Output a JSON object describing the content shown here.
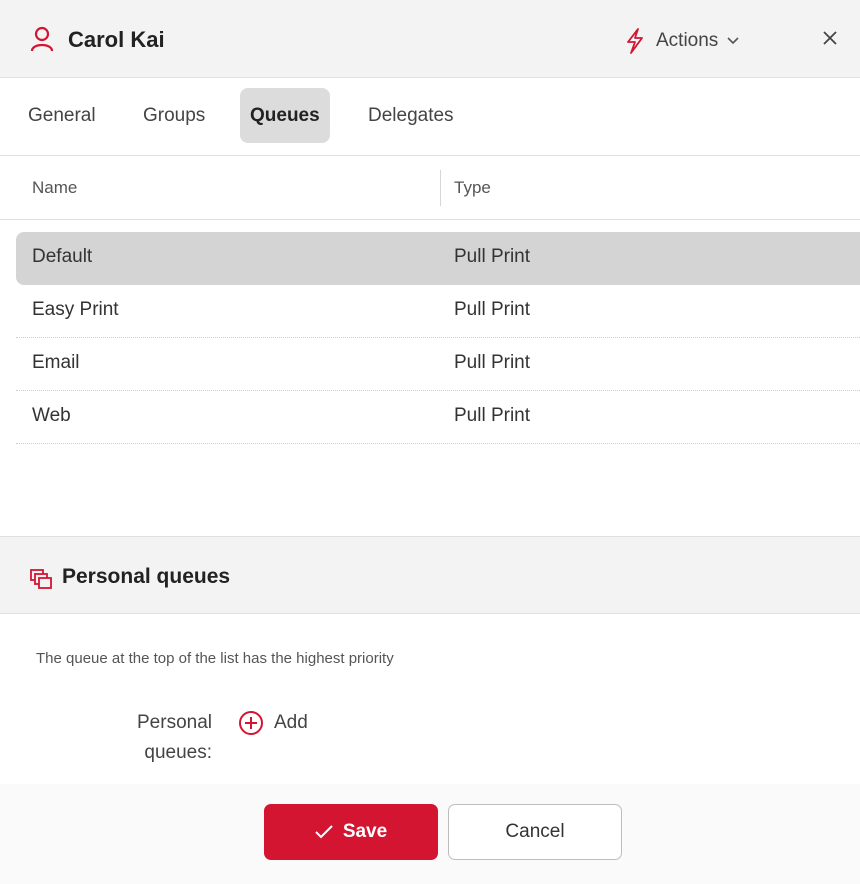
{
  "header": {
    "title": "Carol Kai",
    "actions_label": "Actions",
    "icons": {
      "user": "user-icon",
      "actions": "lightning-icon",
      "close": "close-icon"
    }
  },
  "tabs": [
    {
      "label": "General",
      "active": false
    },
    {
      "label": "Groups",
      "active": false
    },
    {
      "label": "Queues",
      "active": true
    },
    {
      "label": "Delegates",
      "active": false
    }
  ],
  "table": {
    "columns": [
      "Name",
      "Type"
    ],
    "rows": [
      {
        "name": "Default",
        "type": "Pull Print",
        "selected": true
      },
      {
        "name": "Easy Print",
        "type": "Pull Print",
        "selected": false
      },
      {
        "name": "Email",
        "type": "Pull Print",
        "selected": false
      },
      {
        "name": "Web",
        "type": "Pull Print",
        "selected": false
      }
    ]
  },
  "personal_queues": {
    "title": "Personal queues",
    "hint": "The queue at the top of the list has the highest priority",
    "field_label": "Personal queues:",
    "add_label": "Add"
  },
  "footer": {
    "save_label": "Save",
    "cancel_label": "Cancel"
  },
  "colors": {
    "accent": "#d31532",
    "header_bg": "#f3f3f3",
    "selected_row": "#d4d4d4"
  }
}
